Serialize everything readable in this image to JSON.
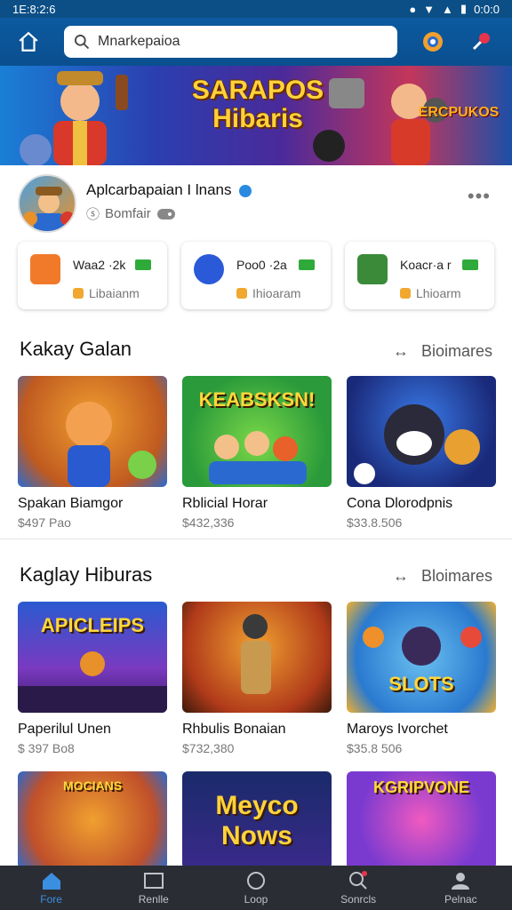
{
  "status": {
    "time": "1E:8:2:6",
    "right_text": "0:0:0"
  },
  "search": {
    "value": "Mnarkepaioa"
  },
  "banner": {
    "title": "SARAPOS Hibaris",
    "subtitle": "ERCPUKOS"
  },
  "profile": {
    "name": "Aplcarbapaian I lnans",
    "meta": "Bomfair"
  },
  "stats": [
    {
      "label": "Waa2 ·2k",
      "sub": "Libaianm",
      "color": "#f07a2a"
    },
    {
      "label": "Poo0 ·2a",
      "sub": "Ihioaram",
      "color": "#2a5ad8"
    },
    {
      "label": "Koacr·a r",
      "sub": "Lhioarm",
      "color": "#3a8a3a"
    }
  ],
  "section1": {
    "title": "Kakay Galan",
    "link": "Bioimares",
    "cards": [
      {
        "title": "Spakan Biamgor",
        "price": "$497 Pao",
        "caption": ""
      },
      {
        "title": "Rblicial Horar",
        "price": "$432,336",
        "caption": "KEABSKSN!"
      },
      {
        "title": "Cona Dlorodpnis",
        "price": "$33.8.506",
        "caption": ""
      }
    ]
  },
  "section2": {
    "title": "Kaglay Hiburas",
    "link": "Bloimares",
    "cards": [
      {
        "title": "Paperilul Unen",
        "price": "$ 397 Bo8",
        "caption": "APICLEIPS"
      },
      {
        "title": "Rhbulis Bonaian",
        "price": "$732,380",
        "caption": ""
      },
      {
        "title": "Maroys Ivorchet",
        "price": "$35.8 506",
        "caption": "SLOTS"
      }
    ]
  },
  "section3": {
    "cards": [
      {
        "caption": "MOCIANS"
      },
      {
        "caption": "Meyco Nows"
      },
      {
        "caption": "KGRIPVONE"
      }
    ]
  },
  "bottomnav": [
    {
      "label": "Fore",
      "icon": "home-icon"
    },
    {
      "label": "Renlle",
      "icon": "library-icon"
    },
    {
      "label": "Loop",
      "icon": "circle-icon"
    },
    {
      "label": "Sonrcls",
      "icon": "search-icon"
    },
    {
      "label": "Pelnac",
      "icon": "profile-icon"
    }
  ]
}
